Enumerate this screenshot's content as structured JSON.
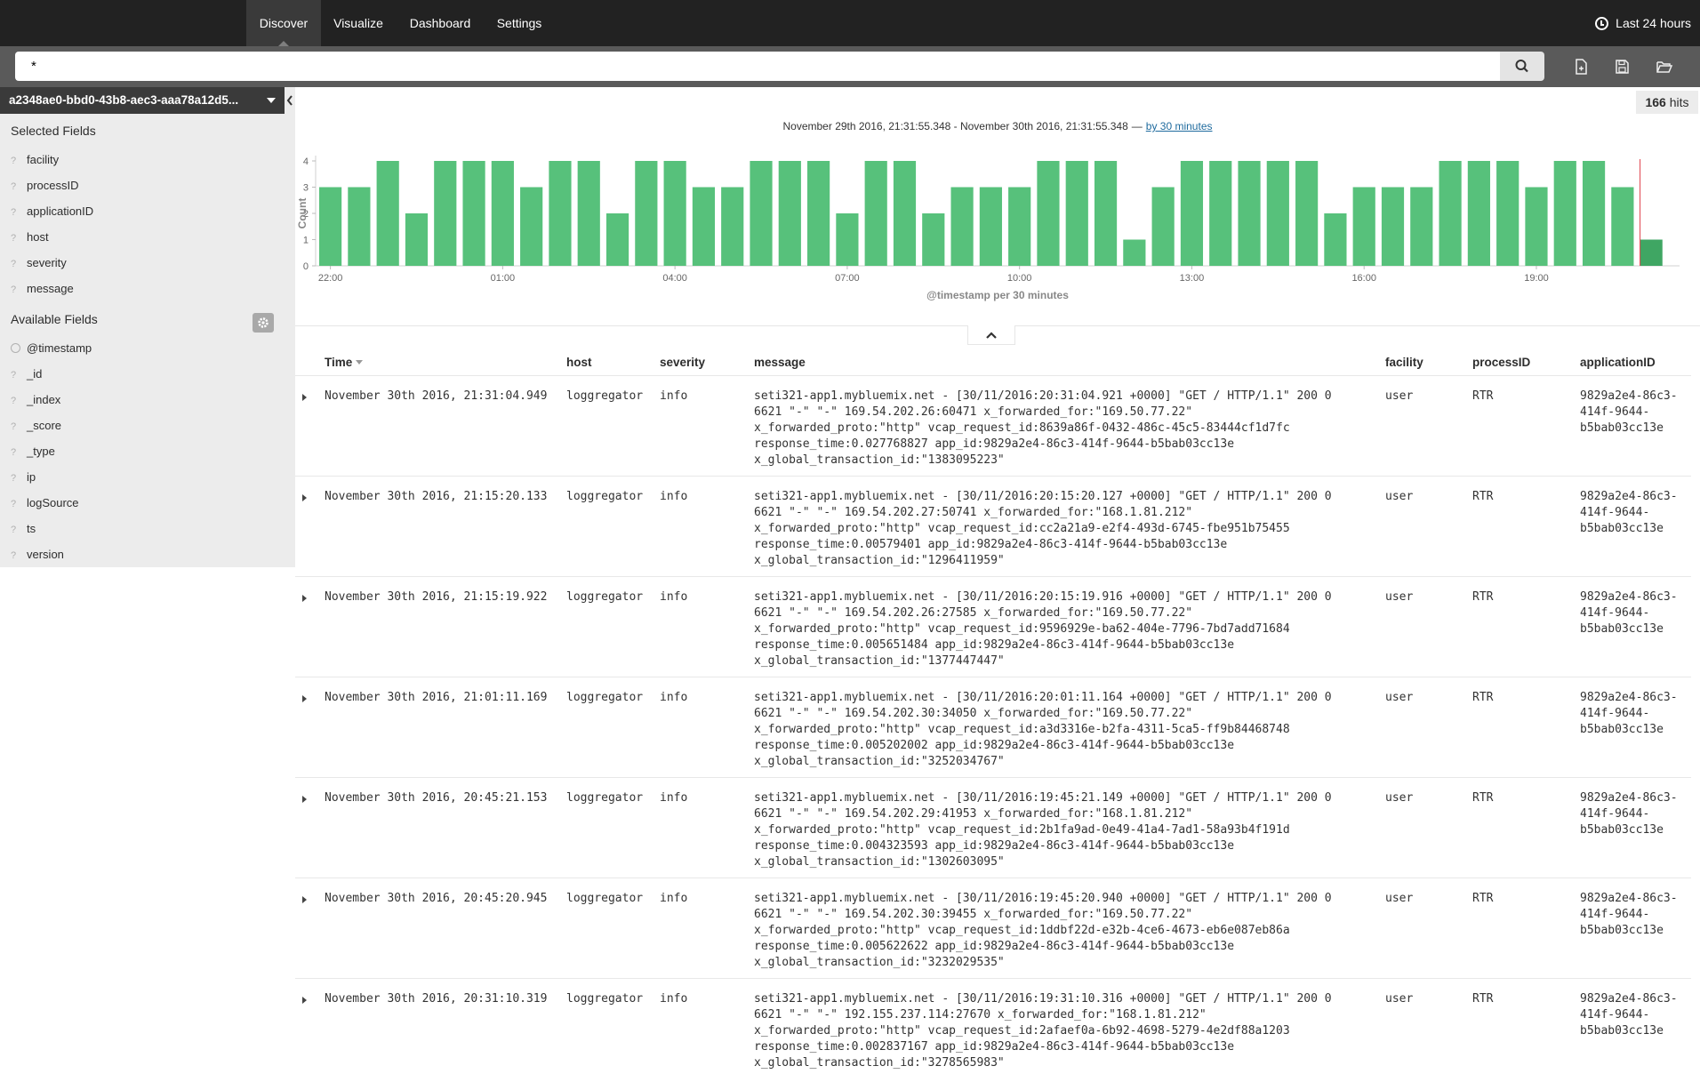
{
  "nav": {
    "tabs": [
      {
        "label": "Discover",
        "active": true
      },
      {
        "label": "Visualize",
        "active": false
      },
      {
        "label": "Dashboard",
        "active": false
      },
      {
        "label": "Settings",
        "active": false
      }
    ],
    "time_range": "Last 24 hours"
  },
  "search": {
    "query": "*"
  },
  "sidebar": {
    "index_pattern": "a2348ae0-bbd0-43b8-aec3-aaa78a12d5...",
    "selected_title": "Selected Fields",
    "selected_fields": [
      "facility",
      "processID",
      "applicationID",
      "host",
      "severity",
      "message"
    ],
    "available_title": "Available Fields",
    "available_fields": [
      "@timestamp",
      "_id",
      "_index",
      "_score",
      "_type",
      "ip",
      "logSource",
      "ts",
      "version"
    ],
    "field_type_glyph": "?"
  },
  "hits": {
    "count": "166",
    "label": "hits"
  },
  "chart_header": {
    "range": "November 29th 2016, 21:31:55.348 - November 30th 2016, 21:31:55.348",
    "separator": "—",
    "interval_link": "by 30 minutes"
  },
  "chart_data": {
    "type": "bar",
    "ylabel": "Count",
    "xlabel": "@timestamp per 30 minutes",
    "ylim": [
      0,
      4
    ],
    "yticks": [
      0,
      1,
      2,
      3,
      4
    ],
    "xtick_labels": [
      "22:00",
      "01:00",
      "04:00",
      "07:00",
      "10:00",
      "13:00",
      "16:00",
      "19:00"
    ],
    "values": [
      3,
      3,
      4,
      2,
      4,
      4,
      4,
      3,
      4,
      4,
      2,
      4,
      4,
      3,
      3,
      4,
      4,
      4,
      2,
      4,
      4,
      2,
      3,
      3,
      3,
      4,
      4,
      4,
      1,
      3,
      4,
      4,
      4,
      4,
      4,
      2,
      3,
      3,
      3,
      4,
      4,
      4,
      3,
      4,
      4,
      3,
      1
    ],
    "bar_color": "#57c17b",
    "last_bar_color": "#3fa663",
    "now_marker_color": "#e0434d"
  },
  "table": {
    "columns": [
      "Time",
      "host",
      "severity",
      "message",
      "facility",
      "processID",
      "applicationID"
    ],
    "rows": [
      {
        "time": "November 30th 2016, 21:31:04.949",
        "host": "loggregator",
        "severity": "info",
        "message": "seti321-app1.mybluemix.net - [30/11/2016:20:31:04.921 +0000] \"GET / HTTP/1.1\" 200 0\n6621 \"-\" \"-\" 169.54.202.26:60471 x_forwarded_for:\"169.50.77.22\"\nx_forwarded_proto:\"http\" vcap_request_id:8639a86f-0432-486c-45c5-83444cf1d7fc\nresponse_time:0.027768827 app_id:9829a2e4-86c3-414f-9644-b5bab03cc13e\nx_global_transaction_id:\"1383095223\"",
        "facility": "user",
        "processID": "RTR",
        "applicationID": "9829a2e4-86c3-\n414f-9644-\nb5bab03cc13e"
      },
      {
        "time": "November 30th 2016, 21:15:20.133",
        "host": "loggregator",
        "severity": "info",
        "message": "seti321-app1.mybluemix.net - [30/11/2016:20:15:20.127 +0000] \"GET / HTTP/1.1\" 200 0\n6621 \"-\" \"-\" 169.54.202.27:50741 x_forwarded_for:\"168.1.81.212\"\nx_forwarded_proto:\"http\" vcap_request_id:cc2a21a9-e2f4-493d-6745-fbe951b75455\nresponse_time:0.00579401 app_id:9829a2e4-86c3-414f-9644-b5bab03cc13e\nx_global_transaction_id:\"1296411959\"",
        "facility": "user",
        "processID": "RTR",
        "applicationID": "9829a2e4-86c3-\n414f-9644-\nb5bab03cc13e"
      },
      {
        "time": "November 30th 2016, 21:15:19.922",
        "host": "loggregator",
        "severity": "info",
        "message": "seti321-app1.mybluemix.net - [30/11/2016:20:15:19.916 +0000] \"GET / HTTP/1.1\" 200 0\n6621 \"-\" \"-\" 169.54.202.26:27585 x_forwarded_for:\"169.50.77.22\"\nx_forwarded_proto:\"http\" vcap_request_id:9596929e-ba62-404e-7796-7bd7add71684\nresponse_time:0.005651484 app_id:9829a2e4-86c3-414f-9644-b5bab03cc13e\nx_global_transaction_id:\"1377447447\"",
        "facility": "user",
        "processID": "RTR",
        "applicationID": "9829a2e4-86c3-\n414f-9644-\nb5bab03cc13e"
      },
      {
        "time": "November 30th 2016, 21:01:11.169",
        "host": "loggregator",
        "severity": "info",
        "message": "seti321-app1.mybluemix.net - [30/11/2016:20:01:11.164 +0000] \"GET / HTTP/1.1\" 200 0\n6621 \"-\" \"-\" 169.54.202.30:34050 x_forwarded_for:\"169.50.77.22\"\nx_forwarded_proto:\"http\" vcap_request_id:a3d3316e-b2fa-4311-5ca5-ff9b84468748\nresponse_time:0.005202002 app_id:9829a2e4-86c3-414f-9644-b5bab03cc13e\nx_global_transaction_id:\"3252034767\"",
        "facility": "user",
        "processID": "RTR",
        "applicationID": "9829a2e4-86c3-\n414f-9644-\nb5bab03cc13e"
      },
      {
        "time": "November 30th 2016, 20:45:21.153",
        "host": "loggregator",
        "severity": "info",
        "message": "seti321-app1.mybluemix.net - [30/11/2016:19:45:21.149 +0000] \"GET / HTTP/1.1\" 200 0\n6621 \"-\" \"-\" 169.54.202.29:41953 x_forwarded_for:\"168.1.81.212\"\nx_forwarded_proto:\"http\" vcap_request_id:2b1fa9ad-0e49-41a4-7ad1-58a93b4f191d\nresponse_time:0.004323593 app_id:9829a2e4-86c3-414f-9644-b5bab03cc13e\nx_global_transaction_id:\"1302603095\"",
        "facility": "user",
        "processID": "RTR",
        "applicationID": "9829a2e4-86c3-\n414f-9644-\nb5bab03cc13e"
      },
      {
        "time": "November 30th 2016, 20:45:20.945",
        "host": "loggregator",
        "severity": "info",
        "message": "seti321-app1.mybluemix.net - [30/11/2016:19:45:20.940 +0000] \"GET / HTTP/1.1\" 200 0\n6621 \"-\" \"-\" 169.54.202.30:39455 x_forwarded_for:\"169.50.77.22\"\nx_forwarded_proto:\"http\" vcap_request_id:1ddbf22d-e32b-4ce6-4673-eb6e087eb86a\nresponse_time:0.005622622 app_id:9829a2e4-86c3-414f-9644-b5bab03cc13e\nx_global_transaction_id:\"3232029535\"",
        "facility": "user",
        "processID": "RTR",
        "applicationID": "9829a2e4-86c3-\n414f-9644-\nb5bab03cc13e"
      },
      {
        "time": "November 30th 2016, 20:31:10.319",
        "host": "loggregator",
        "severity": "info",
        "message": "seti321-app1.mybluemix.net - [30/11/2016:19:31:10.316 +0000] \"GET / HTTP/1.1\" 200 0\n6621 \"-\" \"-\" 192.155.237.114:27670 x_forwarded_for:\"168.1.81.212\"\nx_forwarded_proto:\"http\" vcap_request_id:2afaef0a-6b92-4698-5279-4e2df88a1203\nresponse_time:0.002837167 app_id:9829a2e4-86c3-414f-9644-b5bab03cc13e\nx_global_transaction_id:\"3278565983\"",
        "facility": "user",
        "processID": "RTR",
        "applicationID": "9829a2e4-86c3-\n414f-9644-\nb5bab03cc13e"
      }
    ]
  }
}
